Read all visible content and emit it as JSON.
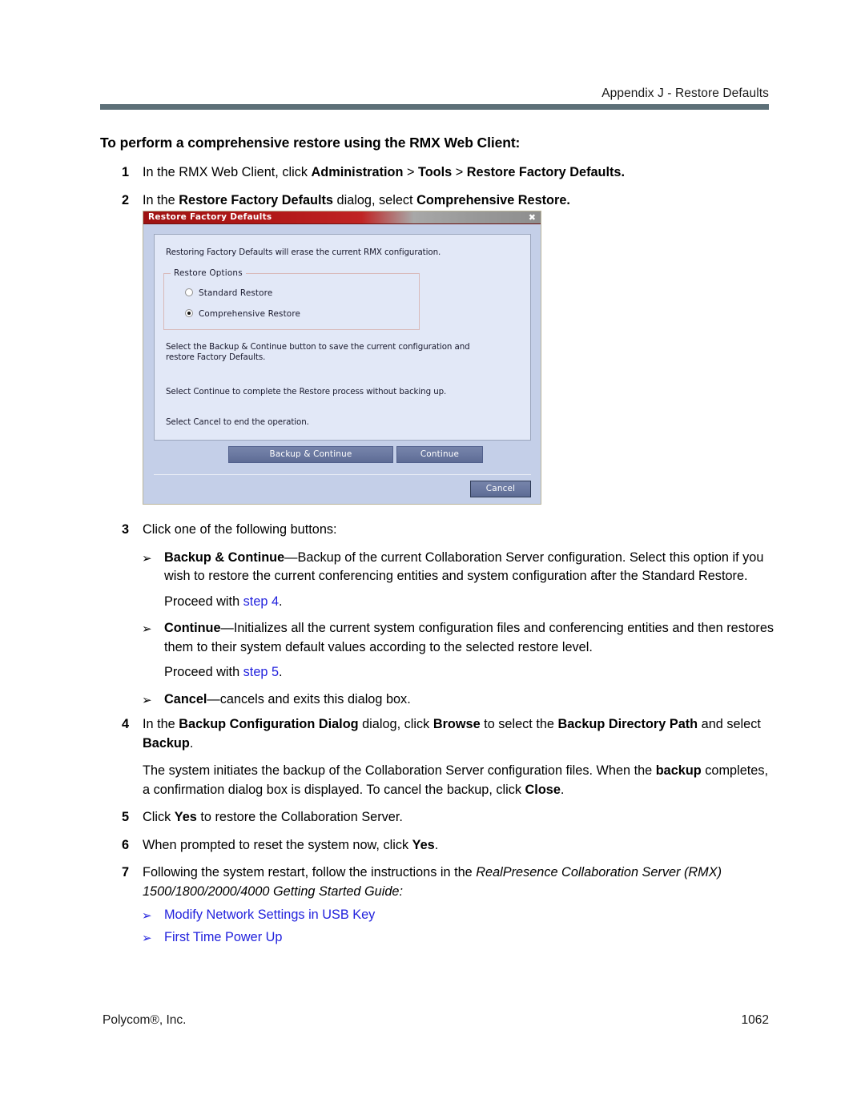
{
  "header": {
    "running_head": "Appendix J - Restore Defaults"
  },
  "title": "To perform a comprehensive restore using the RMX Web Client:",
  "steps": {
    "s1": {
      "num": "1"
    },
    "s2": {
      "num": "2"
    },
    "s3": {
      "num": "3",
      "text": "Click one of the following buttons:"
    },
    "s4": {
      "num": "4"
    },
    "s5": {
      "num": "5"
    },
    "s6": {
      "num": "6"
    },
    "s7": {
      "num": "7"
    }
  },
  "arrow_glyph": "➢",
  "bullets": {
    "backup_label": "Backup & Continue",
    "continue_label": "Continue",
    "cancel_label": "Cancel",
    "proceed_4_prefix": "Proceed with ",
    "proceed_4_link": "step 4",
    "proceed_5_prefix": "Proceed with ",
    "proceed_5_link": "step 5",
    "period": ".",
    "link_usb": "Modify Network Settings in USB Key",
    "link_power": "First Time Power Up"
  },
  "dialog": {
    "title": "Restore Factory Defaults",
    "close_glyph": "✖",
    "warning": "Restoring Factory Defaults will erase the current RMX configuration.",
    "group_legend": "Restore Options",
    "options": [
      {
        "label": "Standard Restore",
        "selected": false
      },
      {
        "label": "Comprehensive Restore",
        "selected": true
      }
    ],
    "note_backup": "Select the Backup & Continue button to save the current configuration and restore Factory Defaults.",
    "note_continue": "Select Continue to complete the Restore process without backing up.",
    "note_cancel": "Select Cancel to end the operation.",
    "buttons": {
      "backup_continue": "Backup & Continue",
      "continue": "Continue",
      "cancel": "Cancel"
    },
    "colors": {
      "titlebar_red": "#b01717",
      "body_blue": "#c4cfe8",
      "panel_blue": "#e2e8f7",
      "button_slate": "#6b79a1"
    }
  },
  "footer": {
    "company": "Polycom®, Inc.",
    "page_number": "1062"
  },
  "colors": {
    "rule": "#5d7078",
    "link": "#2222dd"
  }
}
